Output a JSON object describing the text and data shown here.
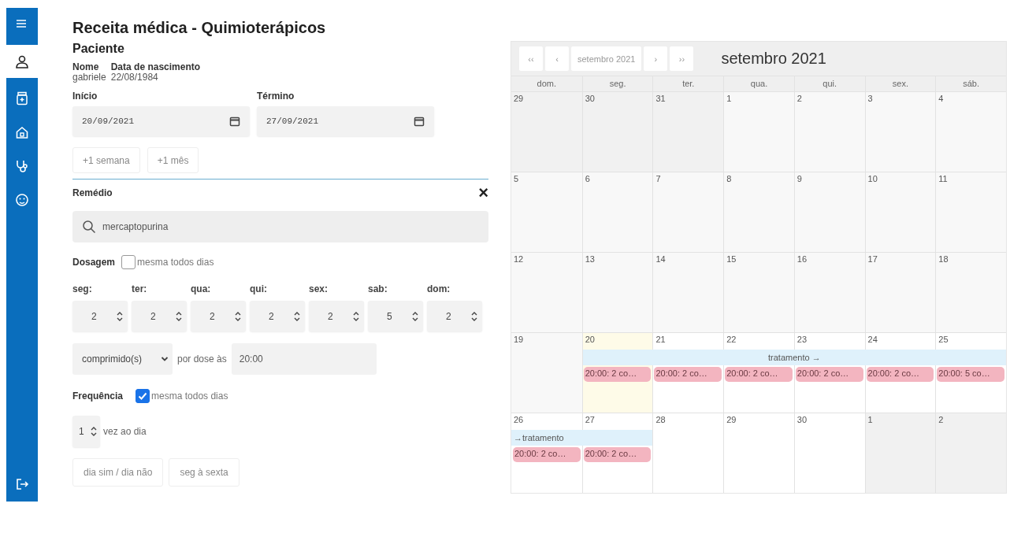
{
  "sidebar": {
    "items": [
      {
        "kind": "menu",
        "selected": false
      },
      {
        "kind": "user",
        "selected": true
      },
      {
        "kind": "medicine",
        "selected": false
      },
      {
        "kind": "home",
        "selected": false
      },
      {
        "kind": "stethoscope",
        "selected": false
      },
      {
        "kind": "face",
        "selected": false
      }
    ],
    "logout": {
      "kind": "logout"
    }
  },
  "form": {
    "title": "Receita médica - Quimioterápicos",
    "section": "Paciente",
    "patient": {
      "name_label": "Nome",
      "name": "gabriele",
      "birth_label": "Data de nascimento",
      "birth": "22/08/1984"
    },
    "start": {
      "label": "Início",
      "value": "20/09/2021"
    },
    "end": {
      "label": "Término",
      "value": "27/09/2021"
    },
    "quick_buttons": [
      "+1 semana",
      "+1 mês"
    ],
    "medicine": {
      "label": "Remédio",
      "close": "×",
      "search_value": "mercaptopurina"
    },
    "dosage": {
      "label": "Dosagem",
      "same_every_day": {
        "label": "mesma todos dias",
        "checked": false
      },
      "days": [
        {
          "label": "seg:",
          "value": "2"
        },
        {
          "label": "ter:",
          "value": "2"
        },
        {
          "label": "qua:",
          "value": "2"
        },
        {
          "label": "qui:",
          "value": "2"
        },
        {
          "label": "sex:",
          "value": "2"
        },
        {
          "label": "sab:",
          "value": "5"
        },
        {
          "label": "dom:",
          "value": "2"
        }
      ]
    },
    "unit": "comprimido(s)",
    "per_dose_label": "por dose às",
    "time": "20:00",
    "frequency": {
      "label": "Frequência",
      "same_every_day": {
        "label": "mesma todos dias",
        "checked": true
      }
    },
    "times_per_day": {
      "value": "1",
      "label": "vez ao dia"
    },
    "pattern_buttons": [
      "dia sim / dia não",
      "seg à sexta"
    ]
  },
  "calendar": {
    "nav_buttons": [
      "‹‹",
      "‹",
      "setembro 2021",
      "›",
      "››"
    ],
    "title": "setembro 2021",
    "weekdays": [
      "dom.",
      "seg.",
      "ter.",
      "qua.",
      "qui.",
      "sex.",
      "sáb."
    ],
    "weeks": [
      {
        "days": [
          {
            "date": "29",
            "kind": "other"
          },
          {
            "date": "30",
            "kind": "other"
          },
          {
            "date": "31",
            "kind": "other"
          },
          {
            "date": "1",
            "kind": "past"
          },
          {
            "date": "2",
            "kind": "past"
          },
          {
            "date": "3",
            "kind": "past"
          },
          {
            "date": "4",
            "kind": "past"
          }
        ]
      },
      {
        "days": [
          {
            "date": "5",
            "kind": "past"
          },
          {
            "date": "6",
            "kind": "past"
          },
          {
            "date": "7",
            "kind": "past"
          },
          {
            "date": "8",
            "kind": "past"
          },
          {
            "date": "9",
            "kind": "past"
          },
          {
            "date": "10",
            "kind": "past"
          },
          {
            "date": "11",
            "kind": "past"
          }
        ]
      },
      {
        "days": [
          {
            "date": "12",
            "kind": "past"
          },
          {
            "date": "13",
            "kind": "past"
          },
          {
            "date": "14",
            "kind": "past"
          },
          {
            "date": "15",
            "kind": "past"
          },
          {
            "date": "16",
            "kind": "past"
          },
          {
            "date": "17",
            "kind": "past"
          },
          {
            "date": "18",
            "kind": "past"
          }
        ]
      },
      {
        "bar": {
          "label": "tratamento →"
        },
        "days": [
          {
            "date": "19",
            "kind": "past",
            "in_treatment": false
          },
          {
            "date": "20",
            "kind": "today",
            "in_treatment": true,
            "dose": "20:00: 2 co…"
          },
          {
            "date": "21",
            "kind": "future",
            "in_treatment": true,
            "dose": "20:00: 2 co…"
          },
          {
            "date": "22",
            "kind": "future",
            "in_treatment": true,
            "dose": "20:00: 2 co…"
          },
          {
            "date": "23",
            "kind": "future",
            "in_treatment": true,
            "dose": "20:00: 2 co…"
          },
          {
            "date": "24",
            "kind": "future",
            "in_treatment": true,
            "dose": "20:00: 2 co…"
          },
          {
            "date": "25",
            "kind": "future",
            "in_treatment": true,
            "dose": "20:00: 5 co…"
          }
        ]
      },
      {
        "bar": {
          "label": "→tratamento"
        },
        "days": [
          {
            "date": "26",
            "kind": "future",
            "in_treatment": true,
            "dose": "20:00: 2 co…"
          },
          {
            "date": "27",
            "kind": "future",
            "in_treatment": true,
            "dose": "20:00: 2 co…"
          },
          {
            "date": "28",
            "kind": "future",
            "in_treatment": false
          },
          {
            "date": "29",
            "kind": "future",
            "in_treatment": false
          },
          {
            "date": "30",
            "kind": "future",
            "in_treatment": false
          },
          {
            "date": "1",
            "kind": "other",
            "in_treatment": false
          },
          {
            "date": "2",
            "kind": "other",
            "in_treatment": false
          }
        ]
      }
    ]
  }
}
